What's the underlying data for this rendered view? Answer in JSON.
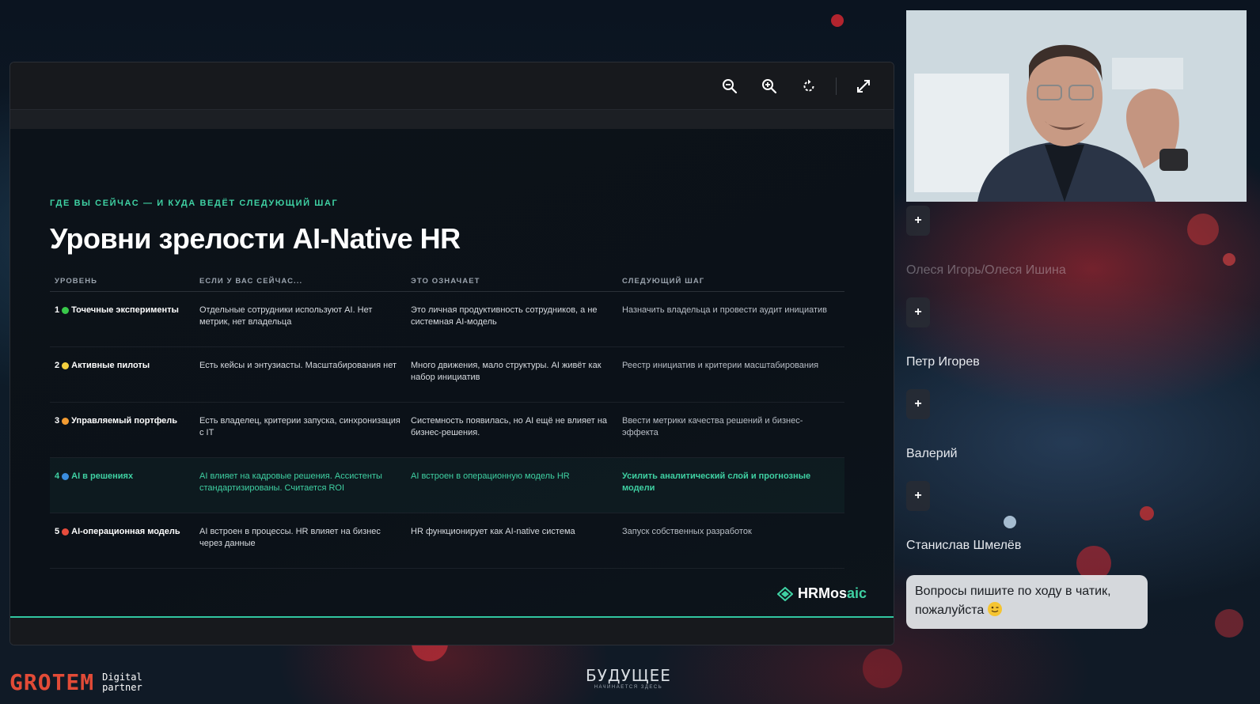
{
  "viewer": {
    "toolbar": {
      "zoom_out_icon": "zoom-out-icon",
      "zoom_in_icon": "zoom-in-icon",
      "rotate_icon": "rotate-icon",
      "fullscreen_icon": "expand-icon"
    },
    "progress_fraction": 1.0
  },
  "slide": {
    "eyebrow": "ГДЕ ВЫ СЕЙЧАС — И КУДА ВЕДЁТ СЛЕДУЮЩИЙ ШАГ",
    "title": "Уровни зрелости AI-Native HR",
    "columns": [
      "УРОВЕНЬ",
      "ЕСЛИ У ВАС СЕЙЧАС...",
      "ЭТО ОЗНАЧАЕТ",
      "СЛЕДУЮЩИЙ ШАГ"
    ],
    "rows": [
      {
        "num": "1",
        "dot_color": "#39c94a",
        "level": "Точечные эксперименты",
        "now": "Отдельные сотрудники используют AI. Нет метрик, нет владельца",
        "means": "Это личная продуктивность сотрудников, а не системная AI-модель",
        "next": "Назначить владельца и провести аудит инициатив"
      },
      {
        "num": "2",
        "dot_color": "#f4d03f",
        "level": "Активные пилоты",
        "now": "Есть кейсы и энтузиасты. Масштабирования нет",
        "means": "Много движения, мало структуры. AI живёт как набор инициатив",
        "next": "Реестр инициатив и критерии масштабирования"
      },
      {
        "num": "3",
        "dot_color": "#f39c32",
        "level": "Управляемый портфель",
        "now": "Есть владелец, критерии запуска, синхронизация с IT",
        "means": "Системность появилась, но AI ещё не влияет на бизнес-решения.",
        "next": "Ввести метрики качества решений и бизнес-эффекта"
      },
      {
        "num": "4",
        "dot_color": "#3a8dde",
        "level": "AI в решениях",
        "now": "AI влияет на кадровые решения. Ассистенты стандартизированы. Считается ROI",
        "means": "AI встроен в операционную модель HR",
        "next": "Усилить аналитический слой и прогнозные модели",
        "highlight": true
      },
      {
        "num": "5",
        "dot_color": "#e74c3c",
        "level": "AI-операционная модель",
        "now": "AI встроен в процессы. HR влияет на бизнес через данные",
        "means": "HR функционирует как AI-native система",
        "next": "Запуск собственных разработок"
      }
    ],
    "brand_part1": "HRMos",
    "brand_part2": "aic"
  },
  "participants": [
    {
      "name": "Олеся Игорь/Олеся Ишина",
      "faded": true
    },
    {
      "name": "Петр Игорев",
      "faded": false
    },
    {
      "name": "Валерий",
      "faded": false
    },
    {
      "name": "Станислав Шмелёв",
      "faded": false
    }
  ],
  "add_button_label": "+",
  "chat": {
    "message": "Вопросы пишите по ходу в чатик, пожалуйста"
  },
  "footer": {
    "grotem": "GROTEM",
    "grotem_sub1": "Digital",
    "grotem_sub2": "partner",
    "future_main": "БУДУЩЕЕ",
    "future_sub": "НАЧИНАЕТСЯ ЗДЕСЬ"
  }
}
